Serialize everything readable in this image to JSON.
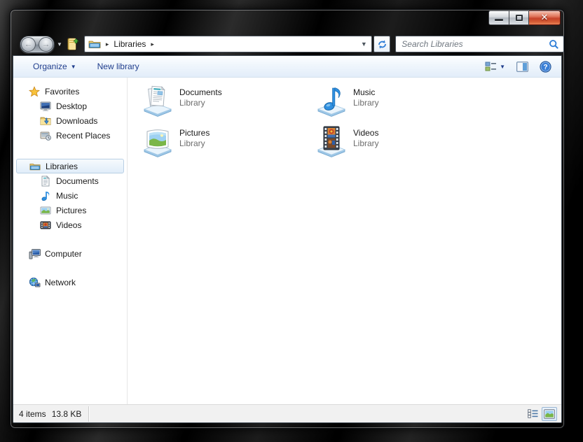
{
  "window": {
    "caption": {
      "minimize": "minimize",
      "maximize": "maximize",
      "close_glyph": "✕"
    },
    "navbar": {
      "crumb_arrow": "▸",
      "address_root": "Libraries",
      "address_dropdown": "▼",
      "search_placeholder": "Search Libraries"
    },
    "toolbar": {
      "organize": "Organize",
      "organize_caret": "▼",
      "new_library": "New library",
      "views_caret": "▼"
    },
    "sidebar": {
      "favorites": {
        "label": "Favorites",
        "items": [
          {
            "label": "Desktop"
          },
          {
            "label": "Downloads"
          },
          {
            "label": "Recent Places"
          }
        ]
      },
      "libraries": {
        "label": "Libraries",
        "items": [
          {
            "label": "Documents"
          },
          {
            "label": "Music"
          },
          {
            "label": "Pictures"
          },
          {
            "label": "Videos"
          }
        ]
      },
      "computer": {
        "label": "Computer"
      },
      "network": {
        "label": "Network"
      }
    },
    "content": {
      "tiles": [
        {
          "name": "Documents",
          "type": "Library"
        },
        {
          "name": "Music",
          "type": "Library"
        },
        {
          "name": "Pictures",
          "type": "Library"
        },
        {
          "name": "Videos",
          "type": "Library"
        }
      ]
    },
    "statusbar": {
      "count": "4 items",
      "size": "13.8 KB"
    }
  },
  "colors": {
    "toolbar_text": "#1f3d8c",
    "close_button_red": "#c64229",
    "accent_blue": "#2c7cd6",
    "selection_border": "#b9cfe4"
  }
}
